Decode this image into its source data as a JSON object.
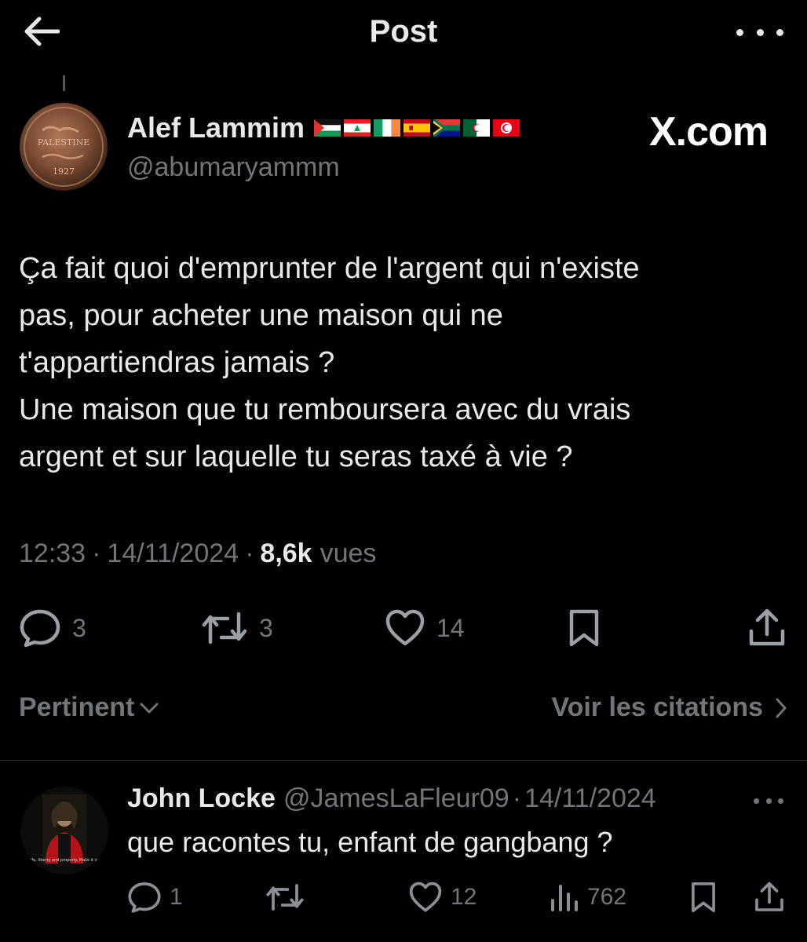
{
  "header": {
    "title": "Post",
    "back_icon": "arrow-left-icon",
    "more_icon": "ellipsis-icon"
  },
  "post": {
    "author": {
      "name": "Alef Lammim",
      "handle": "@abumaryammm",
      "avatar_icon": "palestine-coin-avatar",
      "avatar_text": [
        "PALESTINE",
        "1927"
      ],
      "flags": [
        "palestine",
        "lebanon",
        "ireland",
        "spain",
        "south-africa",
        "algeria",
        "tunisia"
      ]
    },
    "watermark": "X.com",
    "text_lines": [
      "Ça fait quoi d'emprunter de l'argent qui n'existe",
      "pas, pour acheter une maison qui ne",
      "t'appartiendras jamais ?",
      "Une maison que tu remboursera avec du vrais",
      "argent et sur laquelle tu seras taxé à vie ?"
    ],
    "time": "12:33",
    "date": "14/11/2024",
    "views_count": "8,6k",
    "views_label": "vues",
    "meta_separator": "·",
    "actions": {
      "replies": "3",
      "reposts": "3",
      "likes": "14"
    }
  },
  "sort": {
    "label": "Pertinent",
    "quotes_link": "Voir les citations"
  },
  "reply": {
    "name": "John Locke",
    "handle": "@JamesLaFleur09",
    "separator": "·",
    "date": "14/11/2024",
    "text": "que racontes tu, enfant de gangbang ?",
    "avatar_icon": "portrait-avatar",
    "avatar_caption": "\"Life, liberty and property. Make it so.\"",
    "actions": {
      "replies": "1",
      "reposts": "",
      "likes": "12",
      "views": "762"
    }
  },
  "colors": {
    "background": "#000000",
    "text_primary": "#e7e9ea",
    "text_secondary": "#71767b",
    "divider": "#2f3336"
  }
}
